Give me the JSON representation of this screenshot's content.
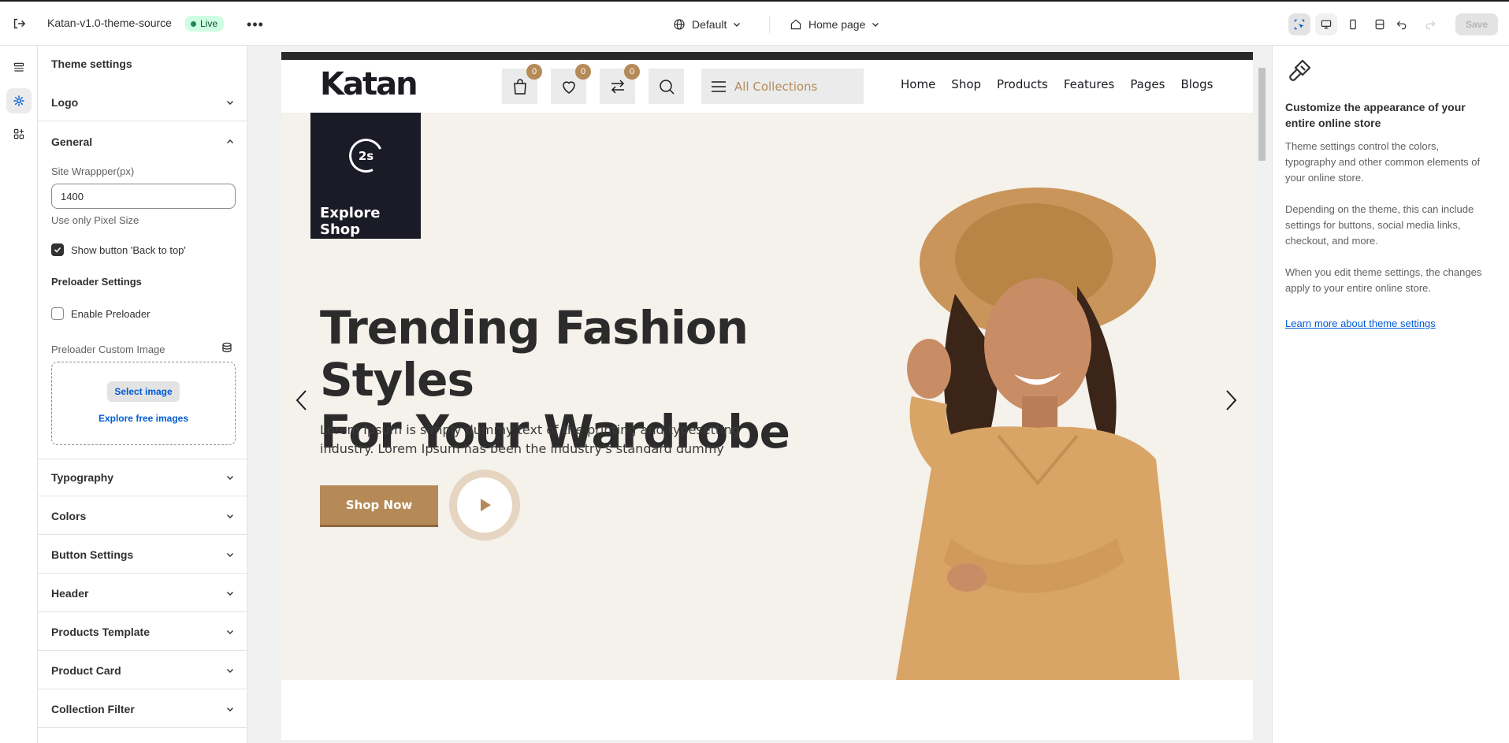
{
  "topbar": {
    "store_title": "Katan-v1.0-theme-source",
    "live_badge": "Live",
    "theme_select": "Default",
    "page_select": "Home page",
    "save_label": "Save"
  },
  "sidebar": {
    "title": "Theme settings",
    "sections": [
      {
        "label": "Logo"
      },
      {
        "label": "General"
      },
      {
        "label": "Typography"
      },
      {
        "label": "Colors"
      },
      {
        "label": "Button Settings"
      },
      {
        "label": "Header"
      },
      {
        "label": "Products Template"
      },
      {
        "label": "Product Card"
      },
      {
        "label": "Collection Filter"
      }
    ],
    "general": {
      "site_wrapper_label": "Site Wrappper(px)",
      "site_wrapper_value": "1400",
      "site_wrapper_hint": "Use only Pixel Size",
      "back_to_top_label": "Show button 'Back to top'",
      "back_to_top_checked": true,
      "preloader_heading": "Preloader Settings",
      "enable_preloader_label": "Enable Preloader",
      "enable_preloader_checked": false,
      "preloader_image_label": "Preloader Custom Image",
      "select_image_label": "Select image",
      "explore_images_label": "Explore free images"
    }
  },
  "preview": {
    "logo_text": "Katan",
    "cart_count": "0",
    "wishlist_count": "0",
    "compare_count": "0",
    "collections_label": "All Collections",
    "nav": [
      "Home",
      "Shop",
      "Products",
      "Features",
      "Pages",
      "Blogs"
    ],
    "explore_timer": "2s",
    "explore_label": "Explore Shop",
    "hero_title_line1": "Trending Fashion Styles",
    "hero_title_line2": "For Your Wardrobe",
    "hero_text": "Lorem Ipsum is simply dummy text of the printing and typesetting industry. Lorem Ipsum has been the industry's standard dummy",
    "shop_button": "Shop Now",
    "colors": {
      "accent": "#b68a57",
      "hero_bg": "#f5f1eb",
      "dark": "#1b1b28"
    }
  },
  "info_panel": {
    "title": "Customize the appearance of your entire online store",
    "para1": "Theme settings control the colors, typography and other common elements of your online store.",
    "para2": "Depending on the theme, this can include settings for buttons, social media links, checkout, and more.",
    "para3": "When you edit theme settings, the changes apply to your entire online store.",
    "link": "Learn more about theme settings"
  }
}
